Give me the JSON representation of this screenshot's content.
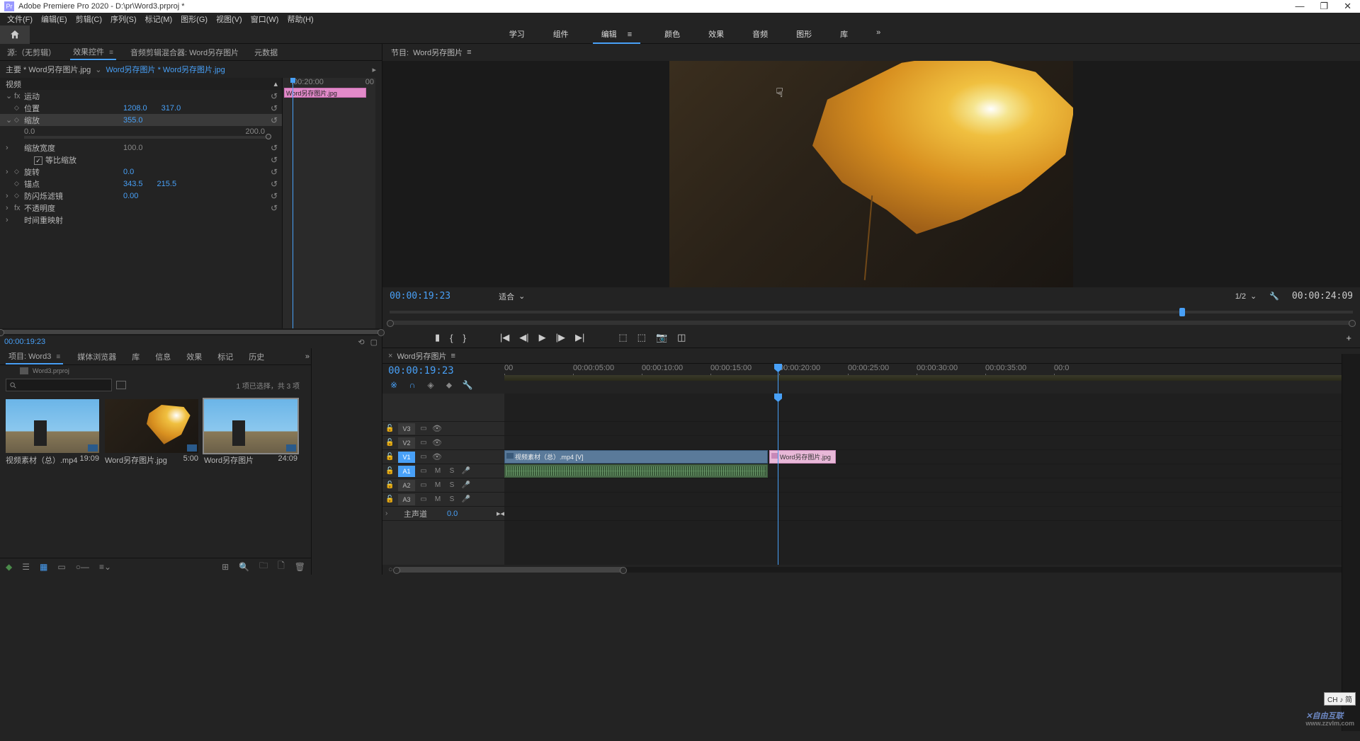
{
  "title_bar": {
    "app_icon_text": "Pr",
    "title": "Adobe Premiere Pro 2020 - D:\\pr\\Word3.prproj *"
  },
  "menu_bar": [
    "文件(F)",
    "编辑(E)",
    "剪辑(C)",
    "序列(S)",
    "标记(M)",
    "图形(G)",
    "视图(V)",
    "窗口(W)",
    "帮助(H)"
  ],
  "workspaces": {
    "items": [
      "学习",
      "组件",
      "编辑",
      "颜色",
      "效果",
      "音频",
      "图形",
      "库"
    ],
    "active": "编辑",
    "overflow": "»"
  },
  "source_tabs": {
    "items": [
      "源:（无剪辑）",
      "效果控件",
      "音频剪辑混合器: Word另存图片",
      "元数据"
    ],
    "active": "效果控件"
  },
  "effect_controls": {
    "master_label": "主要 * Word另存图片.jpg",
    "link_label": "Word另存图片 * Word另存图片.jpg",
    "timeline": {
      "start": ":00:20:00",
      "end": "00",
      "clip_label": "Word另存图片.jpg"
    },
    "video_label": "视频",
    "motion": {
      "label": "运动",
      "position": {
        "label": "位置",
        "x": "1208.0",
        "y": "317.0"
      },
      "scale": {
        "label": "缩放",
        "value": "355.0",
        "min": "0.0",
        "max": "200.0"
      },
      "scale_width": {
        "label": "缩放宽度",
        "value": "100.0"
      },
      "uniform": {
        "label": "等比缩放",
        "checked": true
      },
      "rotation": {
        "label": "旋转",
        "value": "0.0"
      },
      "anchor": {
        "label": "锚点",
        "x": "343.5",
        "y": "215.5"
      },
      "flicker": {
        "label": "防闪烁滤镜",
        "value": "0.00"
      }
    },
    "opacity_label": "不透明度",
    "time_remap_label": "时间重映射",
    "footer_timecode": "00:00:19:23"
  },
  "program": {
    "header_prefix": "节目:",
    "sequence_name": "Word另存图片",
    "timecode": "00:00:19:23",
    "fit_label": "适合",
    "resolution": "1/2",
    "duration": "00:00:24:09"
  },
  "project": {
    "tabs": [
      "项目: Word3",
      "媒体浏览器",
      "库",
      "信息",
      "效果",
      "标记",
      "历史"
    ],
    "active": "项目: Word3",
    "project_file": "Word3.prproj",
    "status": "1 项已选择，共 3 项",
    "bins": [
      {
        "name": "视频素材（总）.mp4",
        "duration": "19:09",
        "type": "sky"
      },
      {
        "name": "Word另存图片.jpg",
        "duration": "5:00",
        "type": "leaf"
      },
      {
        "name": "Word另存图片",
        "duration": "24:09",
        "type": "sky",
        "selected": true
      }
    ]
  },
  "timeline": {
    "header_prefix": "×",
    "sequence_name": "Word另存图片",
    "timecode": "00:00:19:23",
    "ruler_ticks": [
      "00",
      "00:00:05:00",
      "00:00:10:00",
      "00:00:15:00",
      "00:00:20:00",
      "00:00:25:00",
      "00:00:30:00",
      "00:00:35:00",
      "00:0"
    ],
    "video_tracks": [
      {
        "name": "V3",
        "active": false
      },
      {
        "name": "V2",
        "active": false
      },
      {
        "name": "V1",
        "active": true
      }
    ],
    "audio_tracks": [
      {
        "name": "A1",
        "active": true,
        "mute": "M",
        "solo": "S"
      },
      {
        "name": "A2",
        "active": false,
        "mute": "M",
        "solo": "S"
      },
      {
        "name": "A3",
        "active": false,
        "mute": "M",
        "solo": "S"
      }
    ],
    "master": {
      "label": "主声道",
      "value": "0.0"
    },
    "clips": {
      "v1_main": "视频素材（总）.mp4 [V]",
      "v1_pink": "Word另存图片.jpg"
    }
  },
  "ime_badge": "CH ♪ 简",
  "watermark": {
    "main": "自由互联",
    "sub": "www.zzvlm.com"
  }
}
